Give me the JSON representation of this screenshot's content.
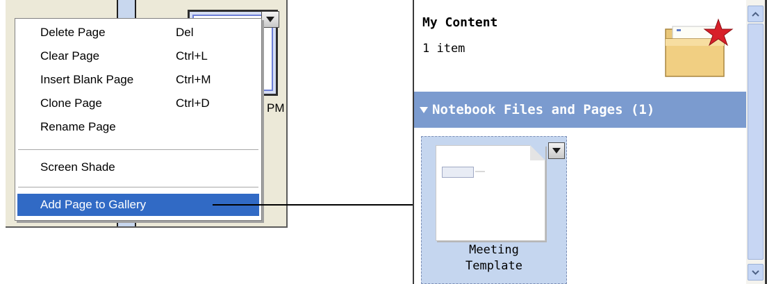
{
  "left_panel": {
    "thumbnail_time_fragment": "PM",
    "context_menu": {
      "items": [
        {
          "label": "Delete Page",
          "shortcut": "Del"
        },
        {
          "label": "Clear Page",
          "shortcut": "Ctrl+L"
        },
        {
          "label": "Insert Blank Page",
          "shortcut": "Ctrl+M"
        },
        {
          "label": "Clone Page",
          "shortcut": "Ctrl+D"
        },
        {
          "label": "Rename Page",
          "shortcut": ""
        },
        {
          "label": "Screen Shade",
          "shortcut": ""
        },
        {
          "label": "Add Page to Gallery",
          "shortcut": ""
        }
      ],
      "highlighted_item": "Add Page to Gallery",
      "highlight_color": "#316ac5"
    }
  },
  "gallery_panel": {
    "my_content": {
      "title": "My Content",
      "count": "1 item",
      "icon": "folder-star-icon"
    },
    "section": {
      "title": "Notebook Files and Pages (1)",
      "color": "#7b9bcf"
    },
    "items": [
      {
        "label_line1": "Meeting",
        "label_line2": "Template"
      }
    ]
  }
}
